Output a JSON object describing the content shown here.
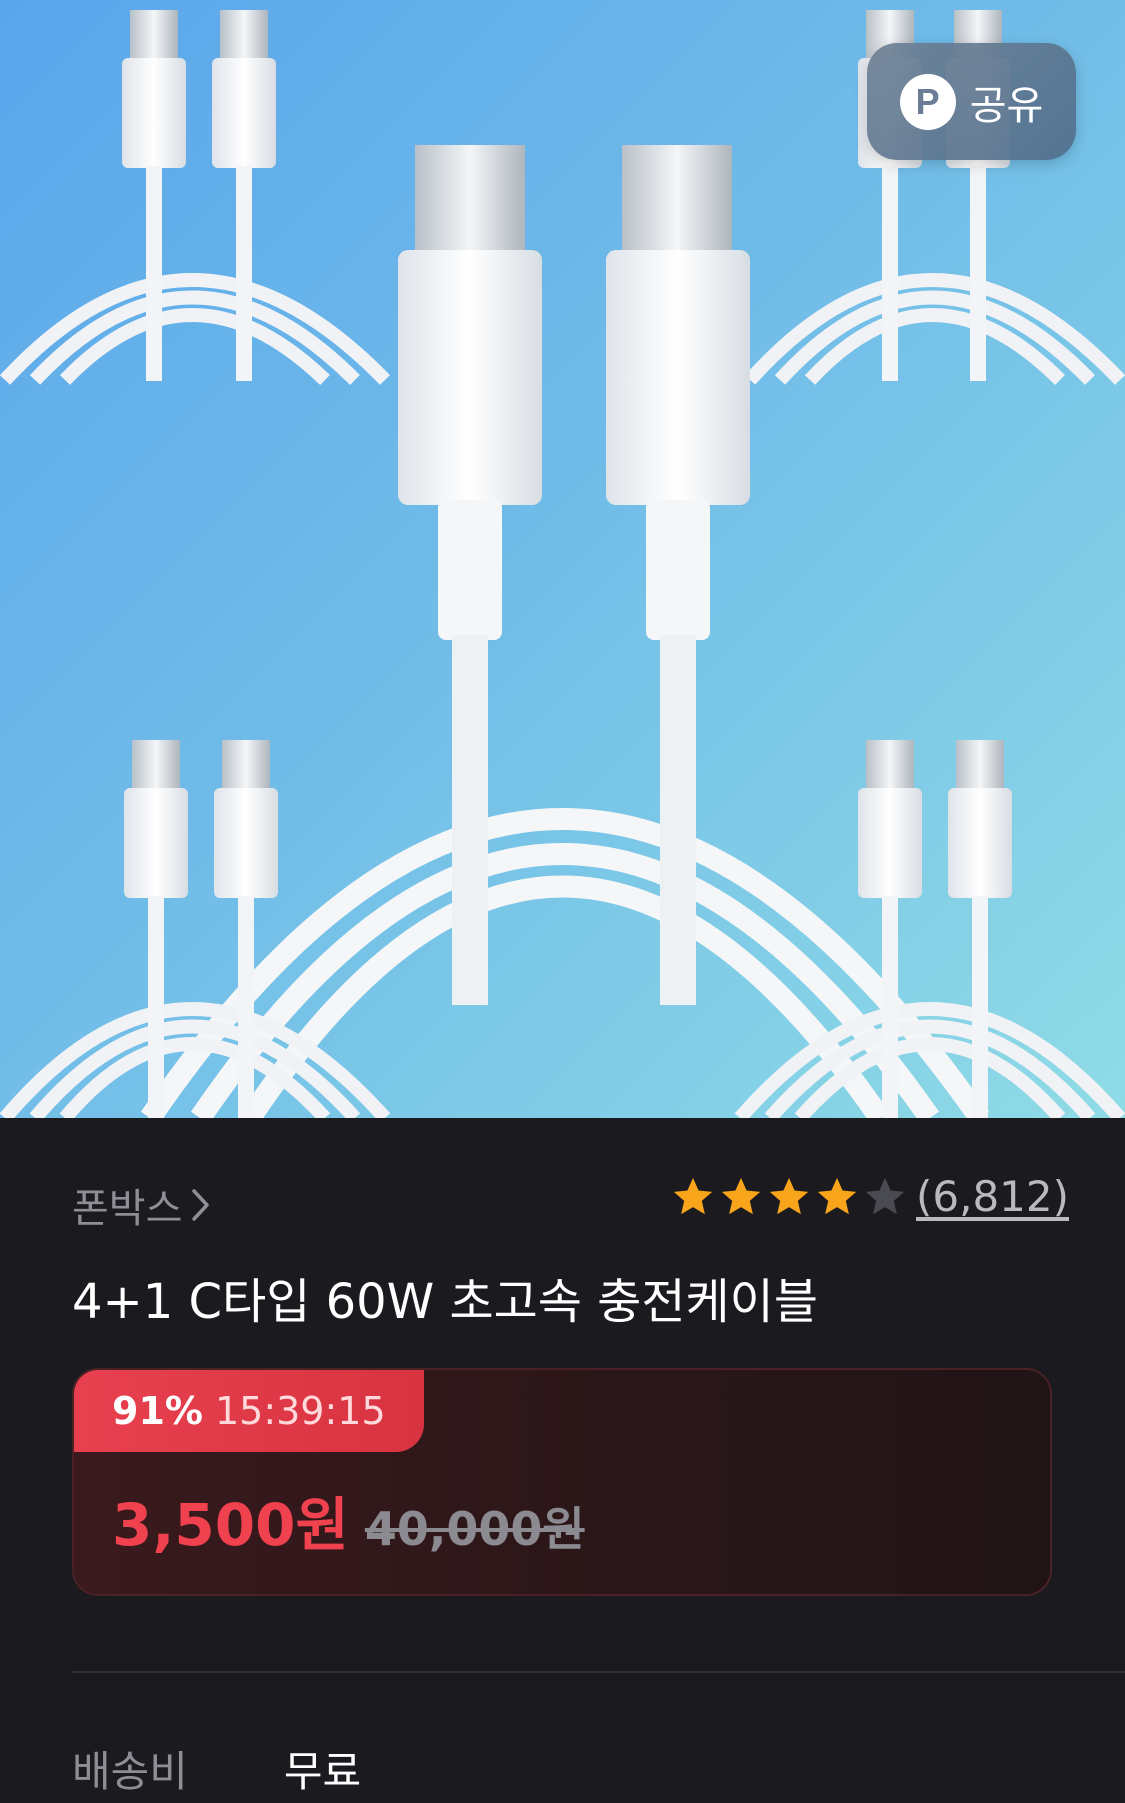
{
  "share": {
    "label": "공유",
    "icon": "P"
  },
  "seller": {
    "name": "폰박스"
  },
  "rating": {
    "stars": 4,
    "max": 5,
    "review_count": "(6,812)"
  },
  "product": {
    "title": "4+1 C타입 60W 초고속 충전케이블"
  },
  "deal": {
    "discount": "91%",
    "timer": "15:39:15",
    "sale_price": "3,500원",
    "original_price": "40,000원"
  },
  "shipping": {
    "label": "배송비",
    "value": "무료"
  },
  "colors": {
    "accent_red": "#f0414f",
    "star_filled": "#f8a51c",
    "star_empty": "#4a4a52",
    "background": "#1a1a1f"
  }
}
